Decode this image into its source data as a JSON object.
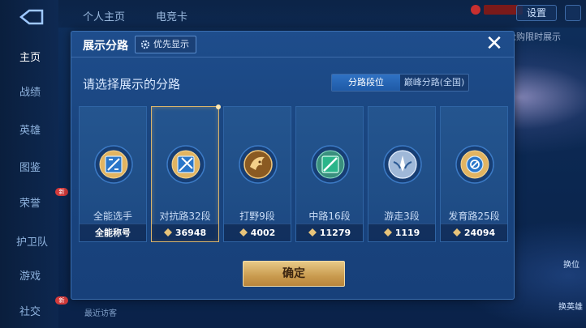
{
  "background": {
    "top_tabs": [
      "个人主页",
      "电竞卡"
    ],
    "settings_label": "设置",
    "banner_text": "抢购限时展示",
    "visitors_text": "最近访客",
    "right_buttons": [
      "换位",
      "换英雄"
    ]
  },
  "left_nav": {
    "items": [
      {
        "label": "主页",
        "active": true
      },
      {
        "label": "战绩",
        "active": false
      },
      {
        "label": "英雄",
        "active": false
      },
      {
        "label": "图鉴",
        "active": false
      },
      {
        "label": "荣誉",
        "active": false
      },
      {
        "label": "护卫队",
        "active": false
      },
      {
        "label": "游戏",
        "active": false
      },
      {
        "label": "社交",
        "active": false
      }
    ],
    "new_badges": [
      "荣誉",
      "社交"
    ],
    "new_badge_text": "新"
  },
  "modal": {
    "title": "展示分路",
    "priority_button": "优先显示",
    "close_icon": "close-icon",
    "prompt": "请选择展示的分路",
    "toggle": {
      "options": [
        "分路段位",
        "巅峰分路(全国)"
      ],
      "selected": "分路段位"
    },
    "cards": [
      {
        "label": "全能选手",
        "foot": "全能称号",
        "has_power": false,
        "selected": false,
        "emblem": "all-round-emblem-icon"
      },
      {
        "label": "对抗路32段",
        "foot": "36948",
        "has_power": true,
        "selected": true,
        "emblem": "clash-lane-emblem-icon"
      },
      {
        "label": "打野9段",
        "foot": "4002",
        "has_power": true,
        "selected": false,
        "emblem": "jungle-emblem-icon"
      },
      {
        "label": "中路16段",
        "foot": "11279",
        "has_power": true,
        "selected": false,
        "emblem": "mid-lane-emblem-icon"
      },
      {
        "label": "游走3段",
        "foot": "1119",
        "has_power": true,
        "selected": false,
        "emblem": "roam-emblem-icon"
      },
      {
        "label": "发育路25段",
        "foot": "24094",
        "has_power": true,
        "selected": false,
        "emblem": "farm-lane-emblem-icon"
      }
    ],
    "confirm_button": "确定"
  },
  "colors": {
    "accent_gold": "#d9b46c",
    "toggle_active": "#2f72c4",
    "modal_bg": "#1e4d8c"
  }
}
